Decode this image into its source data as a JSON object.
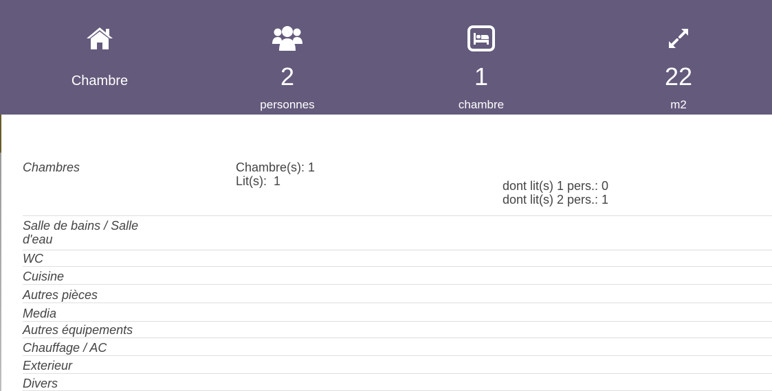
{
  "summary": {
    "type_label": "Chambre",
    "persons": {
      "value": "2",
      "unit": "personnes"
    },
    "bedrooms": {
      "value": "1",
      "unit": "chambre"
    },
    "area": {
      "value": "22",
      "unit": "m2"
    }
  },
  "icons": {
    "type": "home-icon",
    "persons": "users-icon",
    "bedrooms": "bed-icon",
    "area": "expand-icon"
  },
  "colors": {
    "header_bg": "#645a7c",
    "header_text": "#ffffff",
    "row_divider": "#dedede"
  },
  "details": {
    "chambres": {
      "label": "Chambres",
      "count_text": "Chambre(s): 1",
      "beds_text": "Lit(s):  1",
      "single_beds_text": "dont lit(s) 1 pers.: 0",
      "double_beds_text": "dont lit(s) 2 pers.: 1"
    },
    "salle_de_bains": {
      "label_line1": "Salle de bains / Salle",
      "label_line2": "d'eau"
    },
    "wc": {
      "label": "WC"
    },
    "cuisine": {
      "label": "Cuisine"
    },
    "autres_pieces": {
      "label": "Autres pièces"
    },
    "media": {
      "label": "Media"
    },
    "autres_equipements": {
      "label": "Autres équipements"
    },
    "chauffage": {
      "label": "Chauffage / AC"
    },
    "exterieur": {
      "label": "Exterieur"
    },
    "divers": {
      "label": "Divers"
    }
  }
}
